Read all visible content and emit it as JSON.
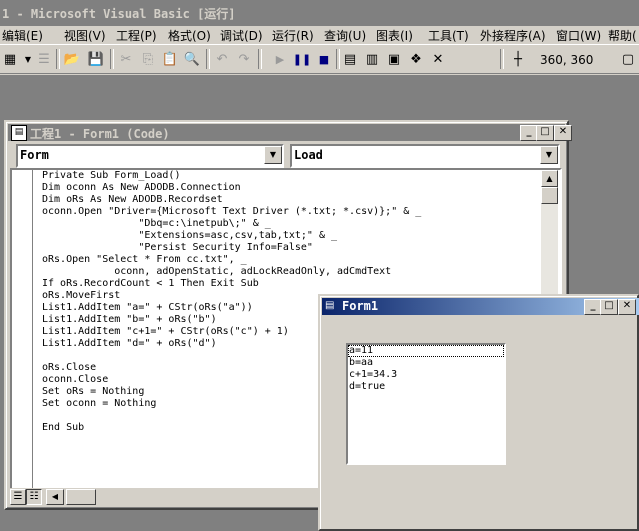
{
  "app": {
    "title": "1 - Microsoft Visual Basic [运行]"
  },
  "menu": [
    "编辑(E)",
    "视图(V)",
    "工程(P)",
    "格式(O)",
    "调试(D)",
    "运行(R)",
    "查询(U)",
    "图表(I)",
    "工具(T)",
    "外接程序(A)",
    "窗口(W)",
    "帮助("
  ],
  "toolbar": {
    "coords": "360,   360"
  },
  "codewindow": {
    "title": "工程1 - Form1 (Code)",
    "object_combo": "Form",
    "procedure_combo": "Load",
    "lines": [
      "Private Sub Form_Load()",
      "Dim oconn As New ADODB.Connection",
      "Dim oRs As New ADODB.Recordset",
      "oconn.Open \"Driver={Microsoft Text Driver (*.txt; *.csv)};\" & _",
      "                \"Dbq=c:\\inetpub\\;\" & _",
      "                \"Extensions=asc,csv,tab,txt;\" & _",
      "                \"Persist Security Info=False\"",
      "oRs.Open \"Select * From cc.txt\", _",
      "            oconn, adOpenStatic, adLockReadOnly, adCmdText",
      "If oRs.RecordCount < 1 Then Exit Sub",
      "oRs.MoveFirst",
      "List1.AddItem \"a=\" + CStr(oRs(\"a\"))",
      "List1.AddItem \"b=\" + oRs(\"b\")",
      "List1.AddItem \"c+1=\" + CStr(oRs(\"c\") + 1)",
      "List1.AddItem \"d=\" + oRs(\"d\")",
      "",
      "oRs.Close",
      "oconn.Close",
      "Set oRs = Nothing",
      "Set oconn = Nothing",
      "",
      "End Sub"
    ]
  },
  "form1": {
    "title": "Form1",
    "list_items": [
      "a=11",
      "b=aa",
      "c+1=34.3",
      "d=true"
    ]
  }
}
